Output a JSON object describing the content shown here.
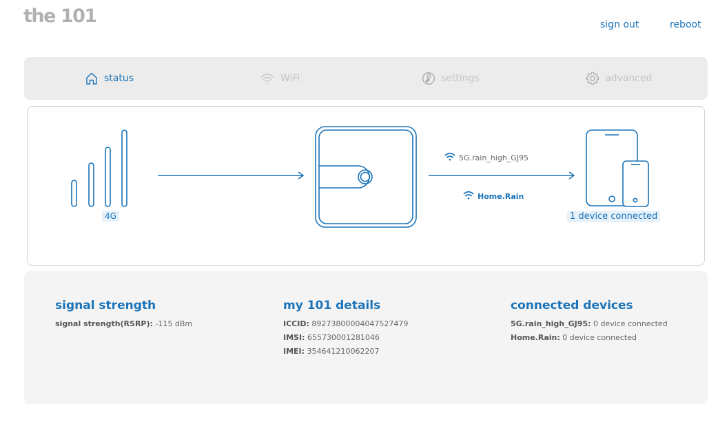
{
  "header": {
    "logo": "the 101",
    "sign_out": "sign out",
    "reboot": "reboot"
  },
  "nav": {
    "status": "status",
    "wifi": "WiFi",
    "settings": "settings",
    "advanced": "advanced",
    "active": "status"
  },
  "diagram": {
    "network_label": "4G",
    "ssid_5g": "5G.rain_high_GJ95",
    "ssid_home": "Home.Rain",
    "devices_label": "1 device connected"
  },
  "details": {
    "signal": {
      "title": "signal strength",
      "rsrp_label": "signal strength(RSRP):",
      "rsrp_value": "-115 dBm"
    },
    "my101": {
      "title": "my 101 details",
      "iccid_label": "ICCID:",
      "iccid_value": "89273800004047527479",
      "imsi_label": "IMSI:",
      "imsi_value": "655730001281046",
      "imei_label": "IMEI:",
      "imei_value": "354641210062207"
    },
    "connected": {
      "title": "connected devices",
      "ssid1_label": "5G.rain_high_GJ95:",
      "ssid1_value": "0 device connected",
      "ssid2_label": "Home.Rain:",
      "ssid2_value": "0 device connected"
    }
  },
  "colors": {
    "accent": "#1a73b8",
    "inactive": "#c4c4c4",
    "panel": "#ececec"
  }
}
